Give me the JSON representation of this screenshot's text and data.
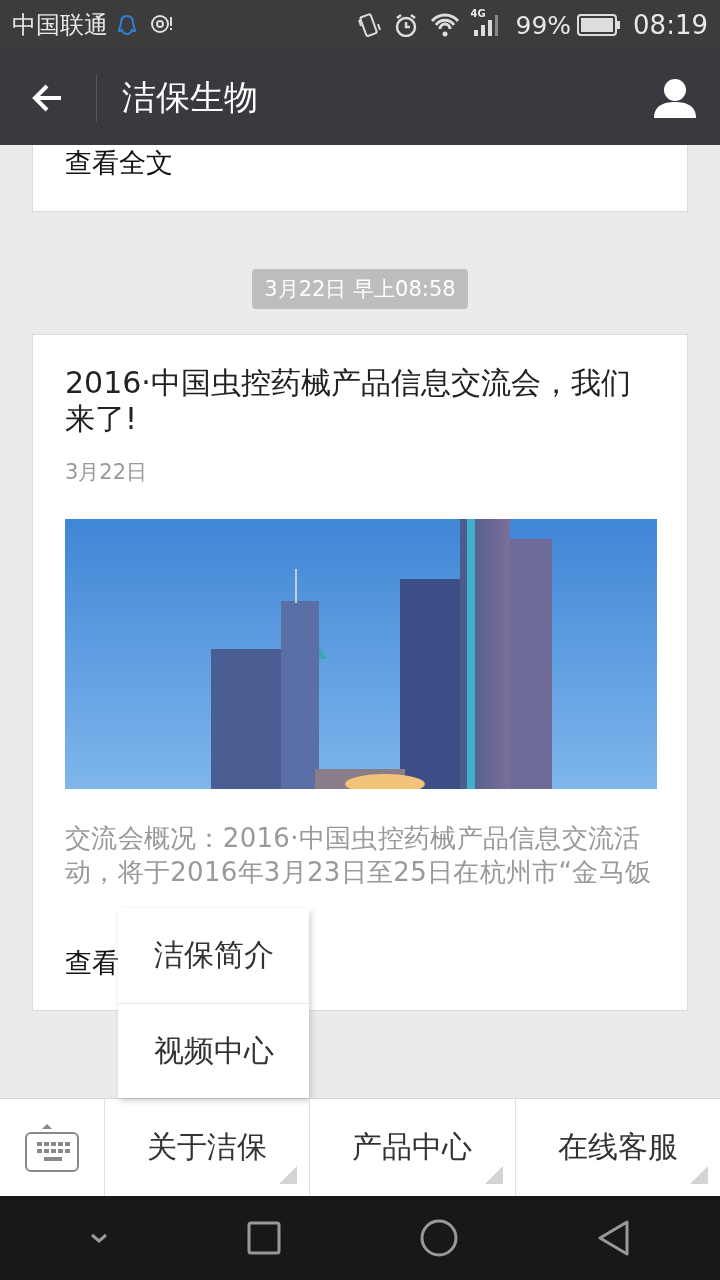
{
  "status_bar": {
    "carrier": "中国联通",
    "network": "4G",
    "battery": "99%",
    "time": "08:19"
  },
  "header": {
    "title": "洁保生物"
  },
  "messages": [
    {
      "kind": "partial",
      "read_more": "查看全文"
    },
    {
      "kind": "timestamp",
      "text": "3月22日 早上08:58"
    },
    {
      "kind": "article",
      "title": "2016·中国虫控药械产品信息交流会，我们来了!",
      "date": "3月22日",
      "summary": "交流会概况：2016·中国虫控药械产品信息交流活动，将于2016年3月23日至25日在杭州市“金马饭",
      "read_more": "查看"
    }
  ],
  "menu": {
    "items": [
      {
        "label": "关于洁保",
        "submenu": [
          "洁保简介",
          "视频中心"
        ]
      },
      {
        "label": "产品中心"
      },
      {
        "label": "在线客服"
      }
    ]
  }
}
